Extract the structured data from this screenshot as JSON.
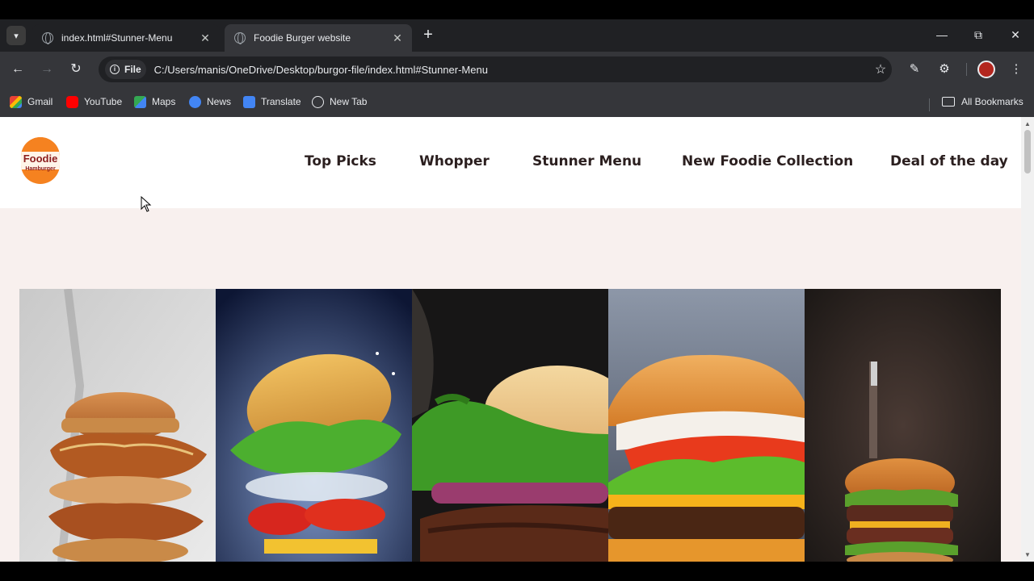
{
  "tabs": [
    {
      "title": "index.html#Stunner-Menu",
      "active": false
    },
    {
      "title": "Foodie Burger website",
      "active": true
    }
  ],
  "toolbar": {
    "chip_label": "File",
    "url": "C:/Users/manis/OneDrive/Desktop/burgor-file/index.html#Stunner-Menu"
  },
  "bookmarks": [
    {
      "label": "Gmail",
      "icon": "gmail-icon"
    },
    {
      "label": "YouTube",
      "icon": "youtube-icon"
    },
    {
      "label": "Maps",
      "icon": "maps-icon"
    },
    {
      "label": "News",
      "icon": "news-icon"
    },
    {
      "label": "Translate",
      "icon": "translate-icon"
    },
    {
      "label": "New Tab",
      "icon": "globe-icon"
    }
  ],
  "all_bookmarks": "All Bookmarks",
  "site": {
    "logo": {
      "line1": "Foodie",
      "line2": "Hamburger"
    },
    "nav": [
      "Top Picks",
      "Whopper",
      "Stunner Menu",
      "New Foodie Collection",
      "Deal of the day"
    ]
  },
  "colors": {
    "accent": "#f58220",
    "brand_text": "#8b1d1d",
    "page_bg": "#f8f0ee"
  }
}
